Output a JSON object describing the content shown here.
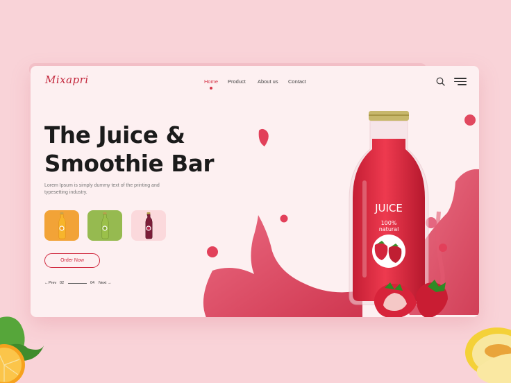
{
  "brand": {
    "logo": "Mixapri"
  },
  "nav": {
    "items": [
      {
        "label": "Home",
        "active": true
      },
      {
        "label": "Product",
        "active": false
      },
      {
        "label": "About us",
        "active": false
      },
      {
        "label": "Contact",
        "active": false
      }
    ]
  },
  "icons": {
    "search": "search-icon",
    "menu": "hamburger-menu-icon"
  },
  "hero": {
    "title_line1": "The Juice &",
    "title_line2": "Smoothie Bar",
    "description": "Lorem Ipsum is simply dummy text of the printing and typesetting industry.",
    "cta": "Order Now"
  },
  "products": [
    {
      "name": "orange-juice",
      "bottle_color": "#f2a12b",
      "bg_color": "#f2a337"
    },
    {
      "name": "green-juice",
      "bottle_color": "#8ab33f",
      "bg_color": "#96ba50"
    },
    {
      "name": "berry-juice",
      "bottle_color": "#7a1c36",
      "bg_color": "#fbd9dc"
    }
  ],
  "pager": {
    "prev": "Prev",
    "current": "02",
    "total": "04",
    "next": "Next"
  },
  "bottle": {
    "label": "JUICE",
    "sub1": "100%",
    "sub2": "natural"
  },
  "colors": {
    "accent": "#d0283e",
    "background": "#f9d3d8",
    "card": "#fdf0f1",
    "juice": "#d9283f"
  }
}
